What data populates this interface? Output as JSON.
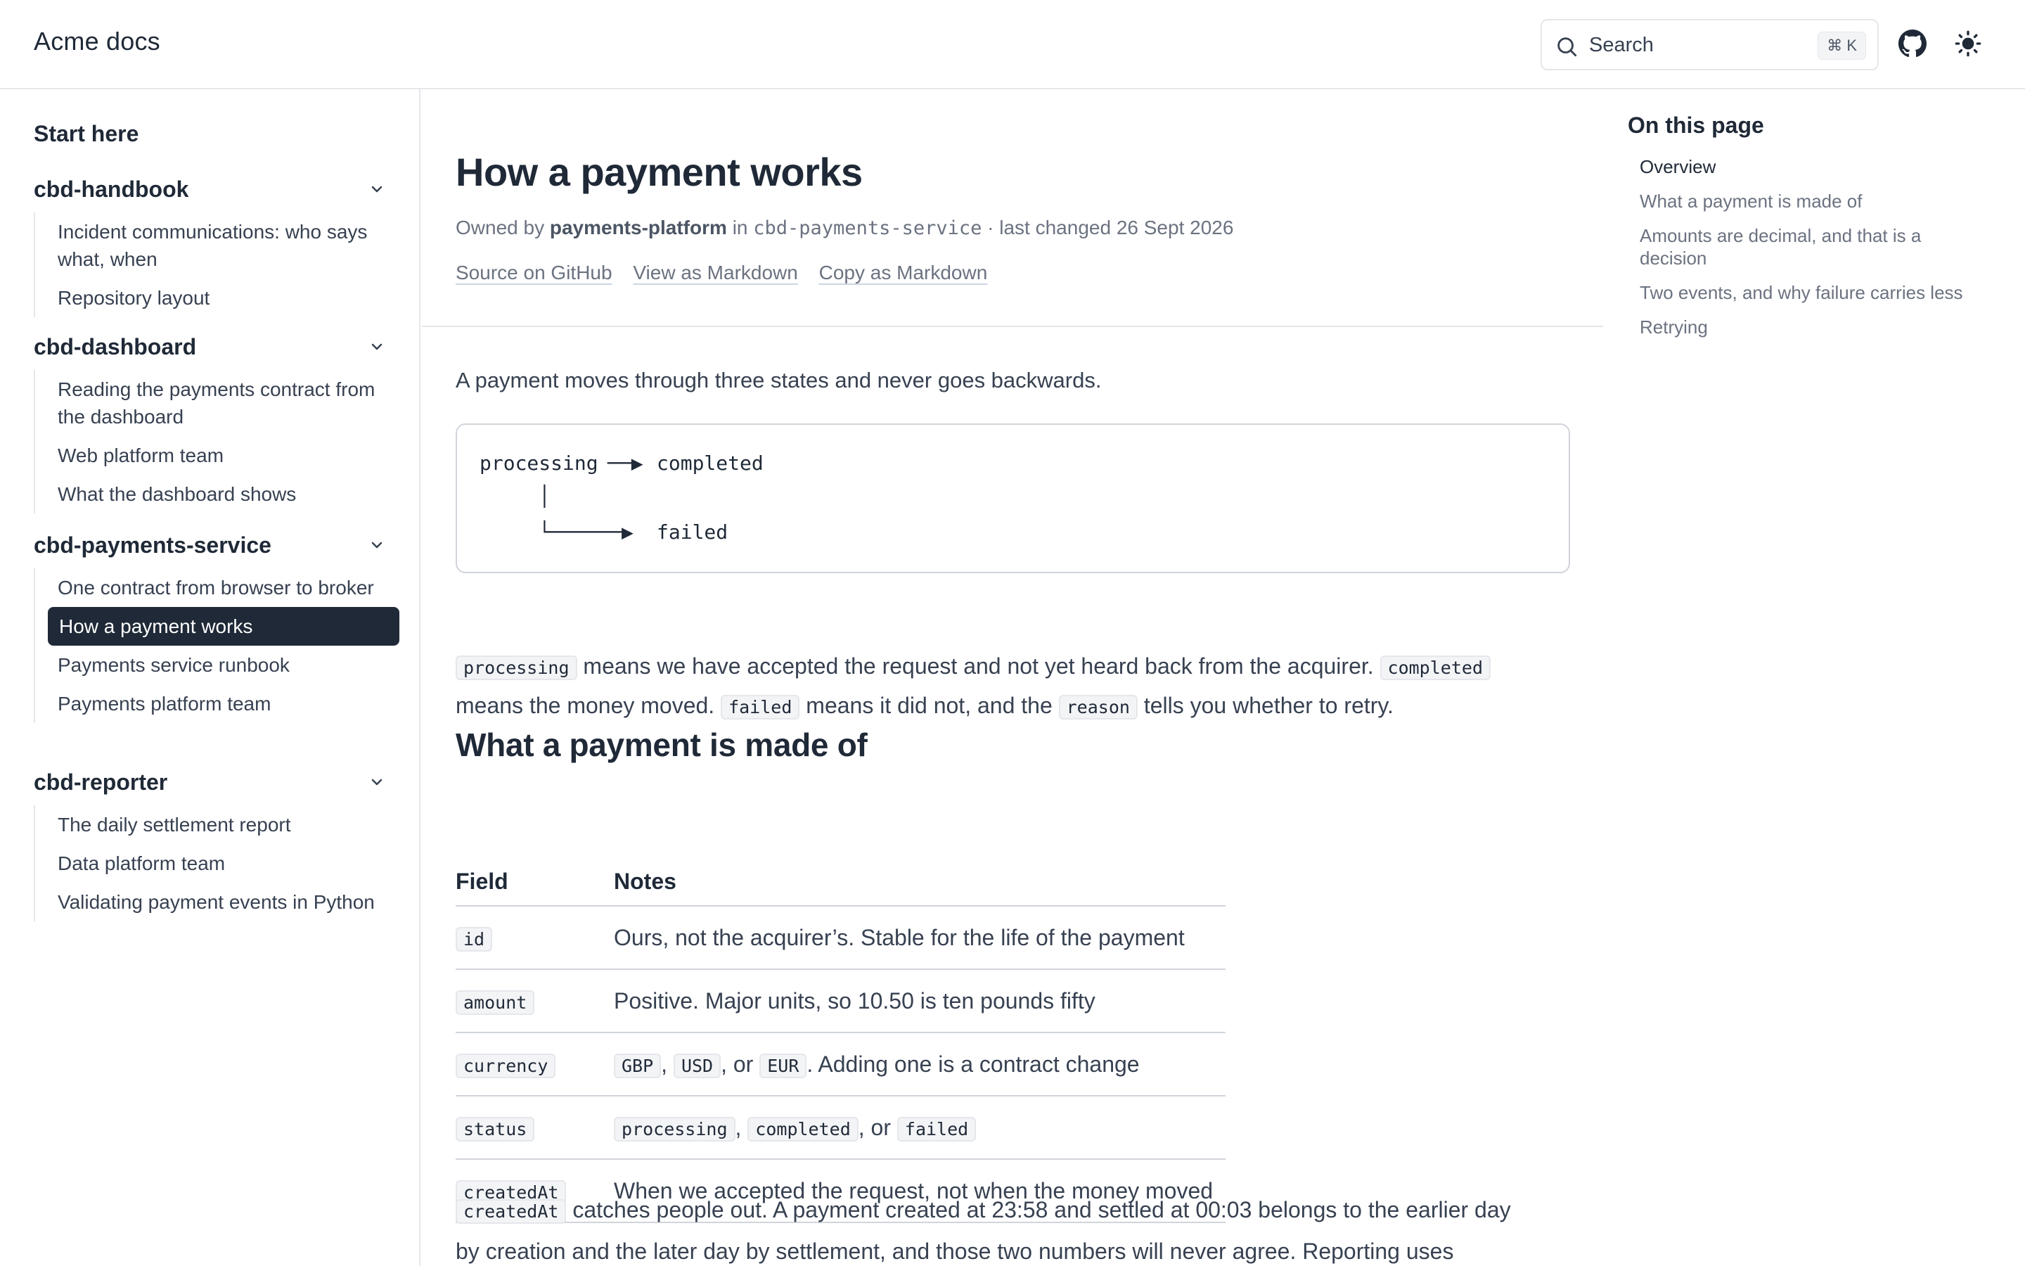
{
  "header": {
    "brand": "Acme docs",
    "search_label": "Search",
    "search_shortcut": "⌘ K",
    "icons": [
      "search-icon",
      "github-icon",
      "sun-icon"
    ]
  },
  "sidebar": {
    "start_here": "Start here",
    "groups": [
      {
        "title": "cbd-handbook",
        "items": [
          "Incident communications: who says what, when",
          "Repository layout"
        ]
      },
      {
        "title": "cbd-dashboard",
        "items": [
          "Reading the payments contract from the dashboard",
          "Web platform team",
          "What the dashboard shows"
        ]
      },
      {
        "title": "cbd-payments-service",
        "items": [
          "One contract from browser to broker",
          "How a payment works",
          "Payments service runbook",
          "Payments platform team"
        ]
      },
      {
        "title": "cbd-reporter",
        "items": [
          "The daily settlement report",
          "Data platform team",
          "Validating payment events in Python"
        ]
      }
    ],
    "active_item": "How a payment works"
  },
  "page": {
    "title": "How a payment works",
    "meta": {
      "owned_by_label": "Owned by",
      "owner": "payments-platform",
      "in_label": "in",
      "repo": "cbd-payments-service",
      "changed": "· last changed 26 Sept 2026"
    },
    "links": [
      "Source on GitHub",
      "View as Markdown",
      "Copy as Markdown"
    ],
    "intro": "A payment moves through three states and never goes backwards.",
    "diagram": {
      "line1_a": "processing",
      "line1_arrow": "──▶",
      "line1_b": "completed",
      "line2": "│",
      "line3_arrow": "└──────▶",
      "line3_b": "failed"
    },
    "states_para": {
      "c1": "processing",
      "t1": " means we have accepted the request and not yet heard back from the acquirer. ",
      "c2": "completed",
      "t2": "means the money moved. ",
      "c3": "failed",
      "t3": " means it did not, and the ",
      "c4": "reason",
      "t4": " tells you whether to retry."
    },
    "section_heading": "What a payment is made of",
    "table": {
      "headers": [
        "Field",
        "Notes"
      ],
      "rows": [
        {
          "field": "id",
          "notes": "Ours, not the acquirer’s. Stable for the life of the payment"
        },
        {
          "field": "amount",
          "notes": "Positive. Major units, so 10.50 is ten pounds fifty"
        },
        {
          "field": "currency",
          "c1": "GBP",
          "s1": ", ",
          "c2": "USD",
          "s2": ", or ",
          "c3": "EUR",
          "tail": ". Adding one is a contract change"
        },
        {
          "field": "status",
          "c1": "processing",
          "s1": ", ",
          "c2": "completed",
          "s2": ", or ",
          "c3": "failed"
        },
        {
          "field": "createdAt",
          "notes": "When we accepted the request, not when the money moved"
        }
      ]
    },
    "created_para": {
      "code": "createdAt",
      "text1": " catches people out. A payment created at 23:58 and settled at 00:03 belongs to the earlier day",
      "text2": "by creation and the later day by settlement, and those two numbers will never agree. Reporting uses"
    }
  },
  "toc": {
    "title": "On this page",
    "items": [
      "Overview",
      "What a payment is made of",
      "Amounts are decimal, and that is a decision",
      "Two events, and why failure carries less",
      "Retrying"
    ],
    "current": "Overview"
  }
}
